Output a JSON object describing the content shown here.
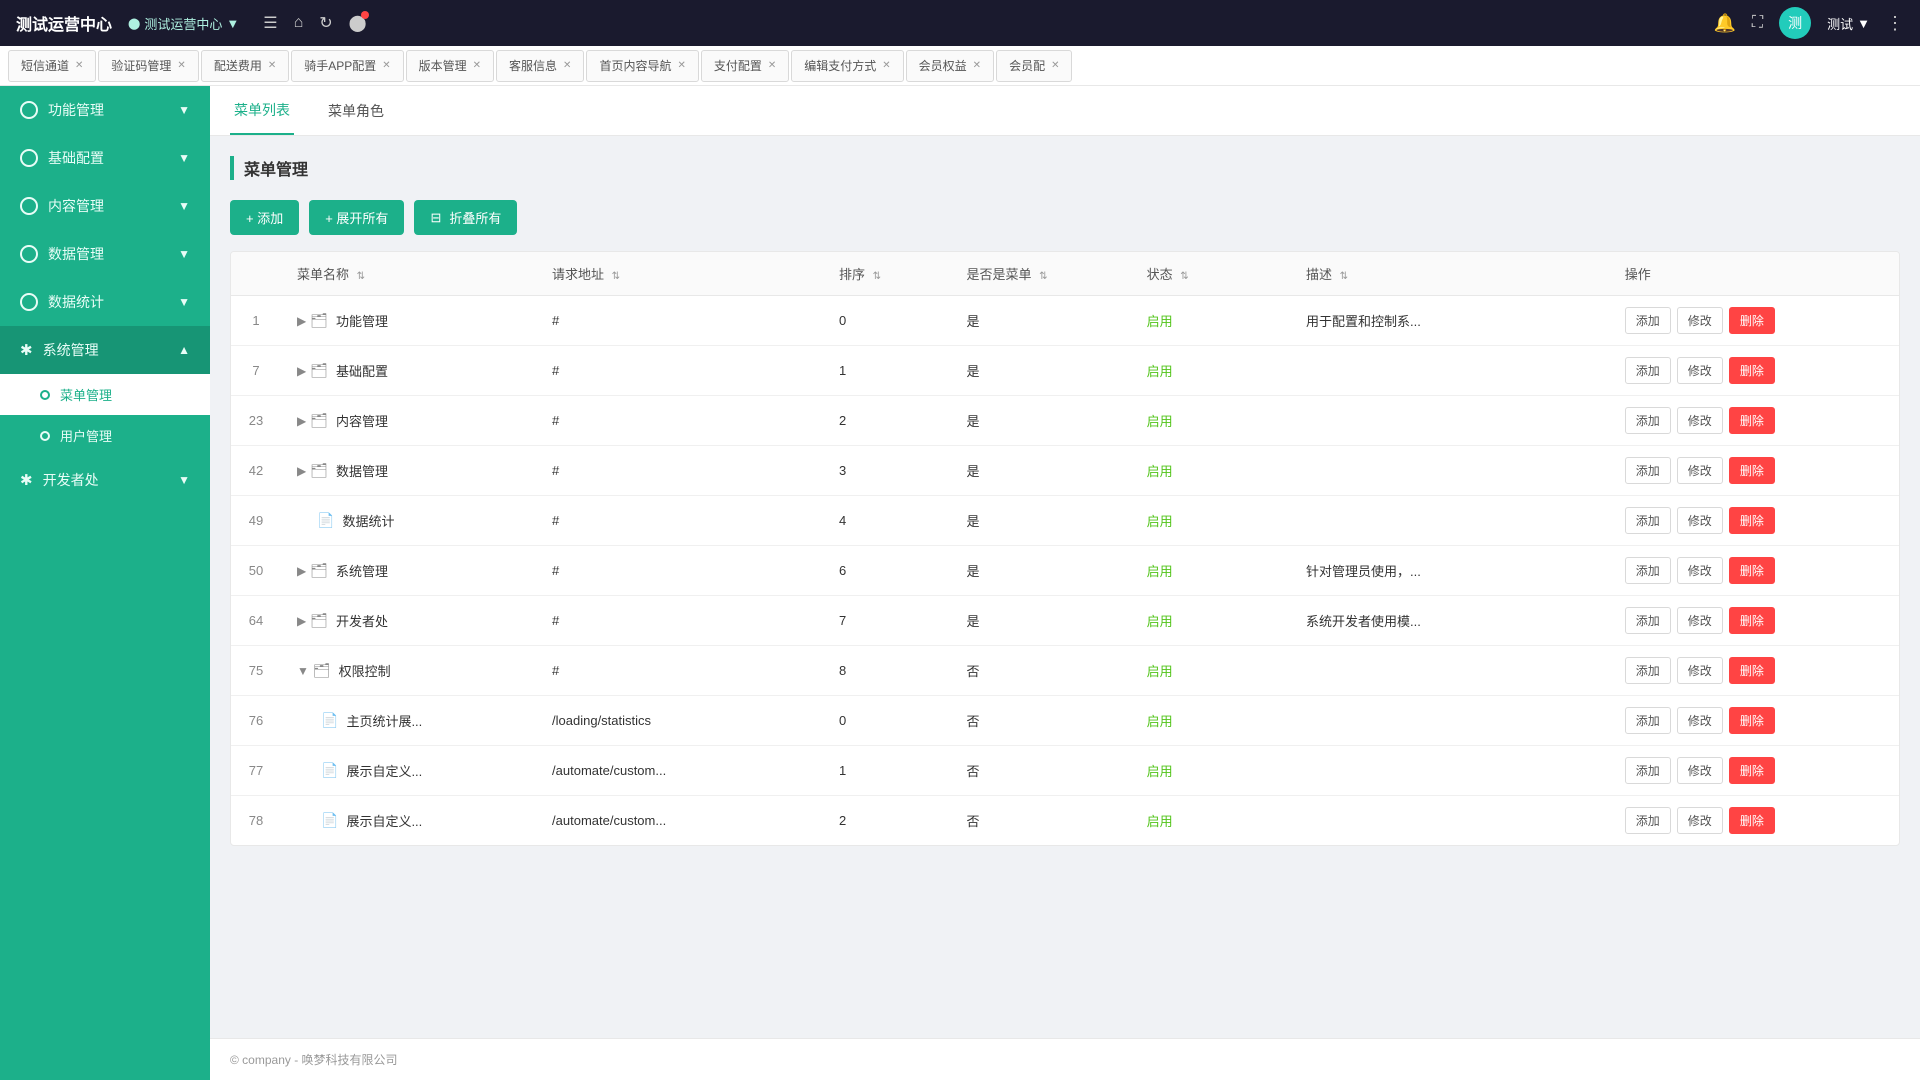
{
  "topbar": {
    "brand": "测试运营中心",
    "nav_label": "测试运营中心",
    "icons": [
      "menu",
      "home",
      "refresh",
      "dot"
    ],
    "user": "测试",
    "user_arrow": "▼"
  },
  "tabs": [
    {
      "label": "短信通道",
      "active": false
    },
    {
      "label": "验证码管理",
      "active": false
    },
    {
      "label": "配送费用",
      "active": false
    },
    {
      "label": "骑手APP配置",
      "active": false
    },
    {
      "label": "版本管理",
      "active": false
    },
    {
      "label": "客服信息",
      "active": false
    },
    {
      "label": "首页内容导航",
      "active": false
    },
    {
      "label": "支付配置",
      "active": false
    },
    {
      "label": "编辑支付方式",
      "active": false
    },
    {
      "label": "会员权益",
      "active": false
    },
    {
      "label": "会员配",
      "active": false
    }
  ],
  "sidebar": {
    "items": [
      {
        "id": "func",
        "label": "功能管理",
        "icon": "circle",
        "expanded": false
      },
      {
        "id": "basic",
        "label": "基础配置",
        "icon": "circle",
        "expanded": false
      },
      {
        "id": "content",
        "label": "内容管理",
        "icon": "circle",
        "expanded": false
      },
      {
        "id": "data",
        "label": "数据管理",
        "icon": "circle",
        "expanded": false
      },
      {
        "id": "stats",
        "label": "数据统计",
        "icon": "circle",
        "expanded": false
      },
      {
        "id": "system",
        "label": "系统管理",
        "icon": "star",
        "expanded": true
      },
      {
        "id": "developer",
        "label": "开发者处",
        "icon": "star",
        "expanded": false
      }
    ],
    "subitems": [
      {
        "id": "menu-mgmt",
        "label": "菜单管理",
        "active": true,
        "parent": "system"
      },
      {
        "id": "user-mgmt",
        "label": "用户管理",
        "active": false,
        "parent": "system"
      }
    ]
  },
  "sec_nav": {
    "items": [
      {
        "label": "菜单列表",
        "active": true
      },
      {
        "label": "菜单角色",
        "active": false
      }
    ]
  },
  "page": {
    "title": "菜单管理",
    "buttons": {
      "add": "+ 添加",
      "expand_all": "+ 展开所有",
      "collapse_all": "折叠所有"
    }
  },
  "table": {
    "columns": [
      {
        "key": "num",
        "label": ""
      },
      {
        "key": "name",
        "label": "菜单名称"
      },
      {
        "key": "url",
        "label": "请求地址"
      },
      {
        "key": "order",
        "label": "排序"
      },
      {
        "key": "is_menu",
        "label": "是否是菜单"
      },
      {
        "key": "status",
        "label": "状态"
      },
      {
        "key": "desc",
        "label": "描述"
      },
      {
        "key": "action",
        "label": "操作"
      }
    ],
    "rows": [
      {
        "id": 1,
        "num": "1",
        "name": "功能管理",
        "url": "#",
        "order": "0",
        "is_menu": "是",
        "status": "启用",
        "desc": "用于配置和控制系...",
        "has_expand": true,
        "has_folder": true,
        "indent": 0,
        "is_leaf": false
      },
      {
        "id": 7,
        "num": "7",
        "name": "基础配置",
        "url": "#",
        "order": "1",
        "is_menu": "是",
        "status": "启用",
        "desc": "",
        "has_expand": true,
        "has_folder": true,
        "indent": 0,
        "is_leaf": false
      },
      {
        "id": 23,
        "num": "23",
        "name": "内容管理",
        "url": "#",
        "order": "2",
        "is_menu": "是",
        "status": "启用",
        "desc": "",
        "has_expand": true,
        "has_folder": true,
        "indent": 0,
        "is_leaf": false
      },
      {
        "id": 42,
        "num": "42",
        "name": "数据管理",
        "url": "#",
        "order": "3",
        "is_menu": "是",
        "status": "启用",
        "desc": "",
        "has_expand": true,
        "has_folder": true,
        "indent": 0,
        "is_leaf": false
      },
      {
        "id": 49,
        "num": "49",
        "name": "数据统计",
        "url": "#",
        "order": "4",
        "is_menu": "是",
        "status": "启用",
        "desc": "",
        "has_expand": false,
        "has_folder": false,
        "indent": 0,
        "is_leaf": true
      },
      {
        "id": 50,
        "num": "50",
        "name": "系统管理",
        "url": "#",
        "order": "6",
        "is_menu": "是",
        "status": "启用",
        "desc": "针对管理员使用，...",
        "has_expand": true,
        "has_folder": true,
        "indent": 0,
        "is_leaf": false
      },
      {
        "id": 64,
        "num": "64",
        "name": "开发者处",
        "url": "#",
        "order": "7",
        "is_menu": "是",
        "status": "启用",
        "desc": "系统开发者使用模...",
        "has_expand": true,
        "has_folder": true,
        "indent": 0,
        "is_leaf": false
      },
      {
        "id": 75,
        "num": "75",
        "name": "权限控制",
        "url": "#",
        "order": "8",
        "is_menu": "否",
        "status": "启用",
        "desc": "",
        "has_expand": true,
        "has_folder": true,
        "indent": 0,
        "is_leaf": false,
        "expanded_down": true
      },
      {
        "id": 76,
        "num": "76",
        "name": "主页统计展...",
        "url": "/loading/statistics",
        "order": "0",
        "is_menu": "否",
        "status": "启用",
        "desc": "",
        "has_expand": false,
        "has_folder": false,
        "indent": 1,
        "is_leaf": true
      },
      {
        "id": 77,
        "num": "77",
        "name": "展示自定义...",
        "url": "/automate/custom...",
        "order": "1",
        "is_menu": "否",
        "status": "启用",
        "desc": "",
        "has_expand": false,
        "has_folder": false,
        "indent": 1,
        "is_leaf": true
      },
      {
        "id": 78,
        "num": "78",
        "name": "展示自定义...",
        "url": "/automate/custom...",
        "order": "2",
        "is_menu": "否",
        "status": "启用",
        "desc": "",
        "has_expand": false,
        "has_folder": false,
        "indent": 1,
        "is_leaf": true
      }
    ],
    "action_labels": {
      "add": "添加",
      "edit": "修改",
      "delete": "删除"
    }
  },
  "footer": {
    "text": "© company - 唤梦科技有限公司"
  }
}
